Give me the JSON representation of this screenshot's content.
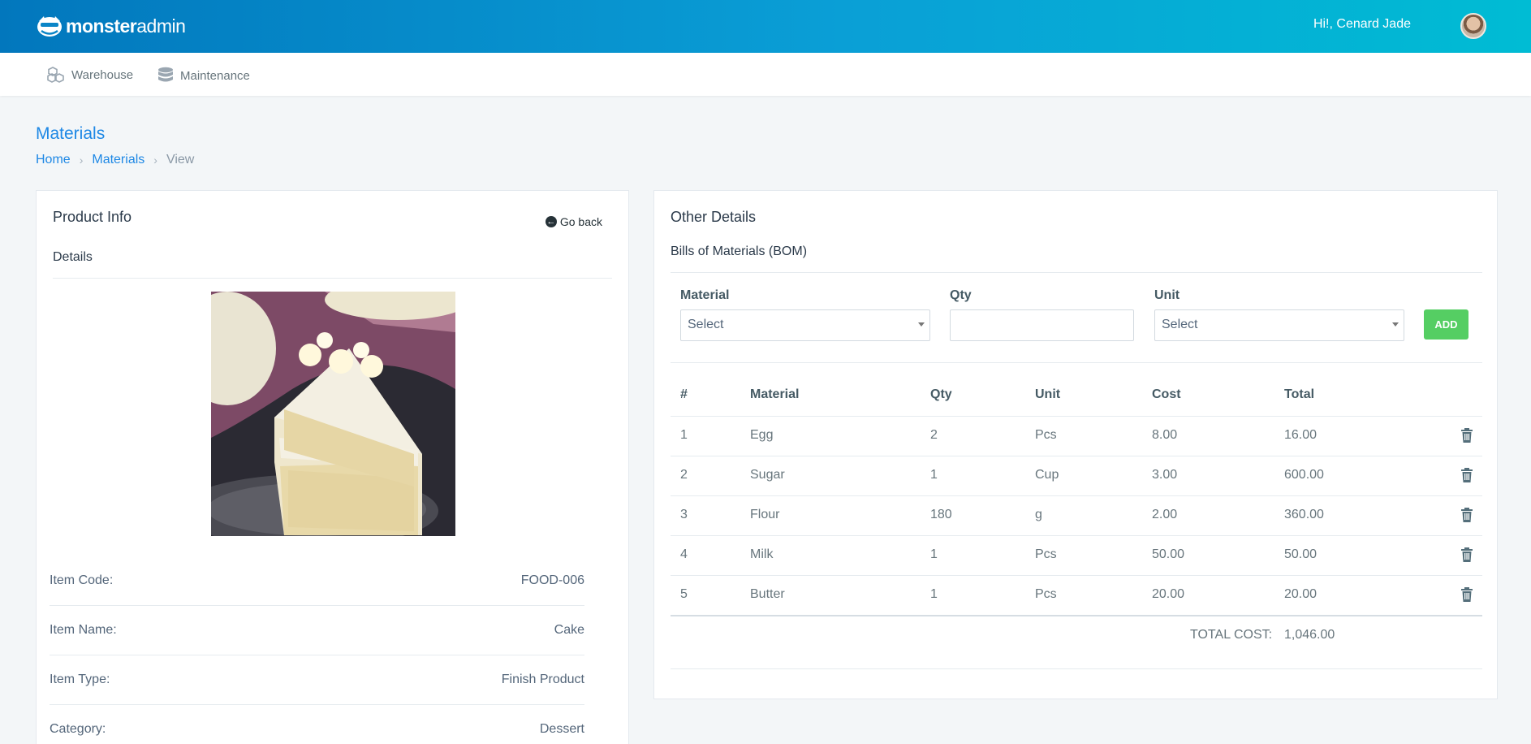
{
  "brand": {
    "bold": "monster",
    "light": "admin"
  },
  "header": {
    "greeting": "Hi!, Cenard Jade"
  },
  "nav": [
    {
      "label": "Warehouse",
      "icon": "boxes-icon"
    },
    {
      "label": "Maintenance",
      "icon": "database-icon"
    }
  ],
  "page": {
    "title": "Materials"
  },
  "breadcrumb": {
    "home": "Home",
    "section": "Materials",
    "current": "View"
  },
  "product": {
    "title": "Product Info",
    "go_back": "Go back",
    "details": "Details",
    "fields": [
      {
        "label": "Item Code:",
        "value": "FOOD-006"
      },
      {
        "label": "Item Name:",
        "value": "Cake"
      },
      {
        "label": "Item Type:",
        "value": "Finish Product"
      },
      {
        "label": "Category:",
        "value": "Dessert"
      }
    ]
  },
  "other": {
    "title": "Other Details",
    "bom_title": "Bills of Materials (BOM)",
    "form": {
      "material_label": "Material",
      "material_value": "Select",
      "qty_label": "Qty",
      "qty_value": "",
      "unit_label": "Unit",
      "unit_value": "Select",
      "add_label": "ADD"
    },
    "table": {
      "headers": [
        "#",
        "Material",
        "Qty",
        "Unit",
        "Cost",
        "Total"
      ],
      "rows": [
        [
          "1",
          "Egg",
          "2",
          "Pcs",
          "8.00",
          "16.00"
        ],
        [
          "2",
          "Sugar",
          "1",
          "Cup",
          "3.00",
          "600.00"
        ],
        [
          "3",
          "Flour",
          "180",
          "g",
          "2.00",
          "360.00"
        ],
        [
          "4",
          "Milk",
          "1",
          "Pcs",
          "50.00",
          "50.00"
        ],
        [
          "5",
          "Butter",
          "1",
          "Pcs",
          "20.00",
          "20.00"
        ]
      ],
      "total_label": "TOTAL COST:",
      "total_value": "1,046.00"
    }
  },
  "colors": {
    "accent": "#1e88e5",
    "success": "#55ce63",
    "header_start": "#0277bd",
    "header_end": "#00bcd4"
  }
}
